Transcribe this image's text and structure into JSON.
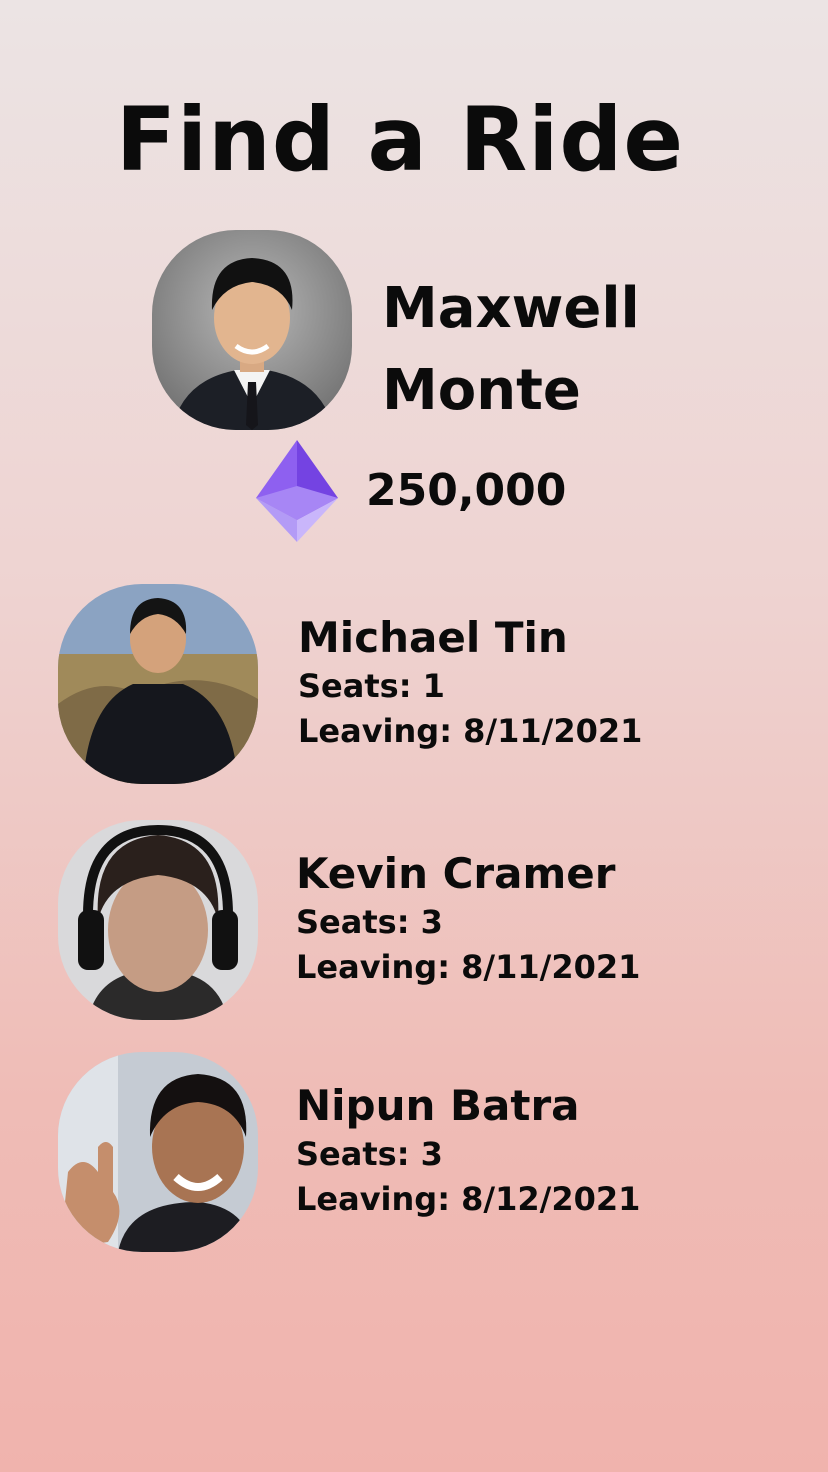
{
  "page": {
    "title": "Find a Ride"
  },
  "user": {
    "first_name": "Maxwell",
    "last_name": "Monte",
    "balance": "250,000",
    "currency_icon": "ethereum-icon"
  },
  "drivers": [
    {
      "name": "Michael Tin",
      "seats": "Seats: 1",
      "leaving": "Leaving: 8/11/2021"
    },
    {
      "name": "Kevin Cramer",
      "seats": "Seats: 3",
      "leaving": "Leaving: 8/11/2021"
    },
    {
      "name": "Nipun Batra",
      "seats": "Seats: 3",
      "leaving": "Leaving: 8/12/2021"
    }
  ],
  "colors": {
    "background_top": "#ece4e4",
    "background_bottom": "#f0b3ad",
    "eth_dark": "#7b4de8",
    "eth_light": "#c4b0fb"
  }
}
